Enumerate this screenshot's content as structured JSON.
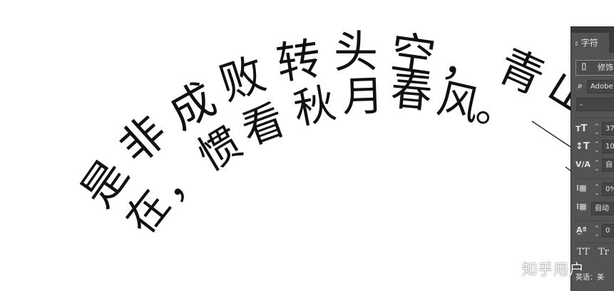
{
  "canvas": {
    "line1": "是非成败转头空，青山",
    "line2": "在，惯看秋月春风。"
  },
  "panel": {
    "tab_label": "字符",
    "font_style_label": "修饰",
    "font_family_value": "Adobe",
    "font_weight_value": "-",
    "font_size_value": "37",
    "leading_value": "10",
    "tracking_value": "自",
    "scale_value": "0%",
    "baseline_auto_value": "自动",
    "baseline_shift_value": "0",
    "tt_caps_label": "TT",
    "tt_small_label": "Tr",
    "language_label": "英语：美"
  },
  "watermark": "知乎用户",
  "colors": {
    "panel_bg": "#535353",
    "panel_field": "#454545",
    "text_ink": "#111111"
  }
}
